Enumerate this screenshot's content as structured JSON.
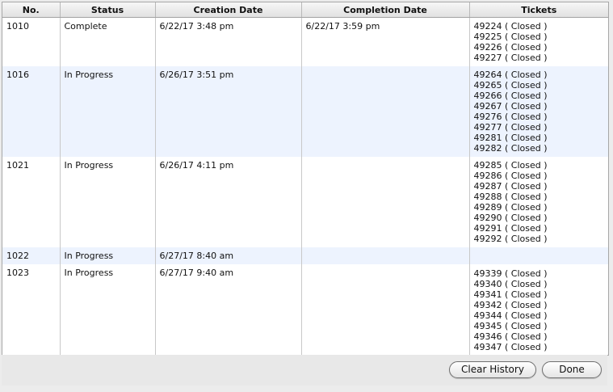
{
  "table": {
    "columns": [
      "No.",
      "Status",
      "Creation Date",
      "Completion Date",
      "Tickets"
    ],
    "rows": [
      {
        "no": "1010",
        "status": "Complete",
        "creation": "6/22/17 3:48 pm",
        "completion": "6/22/17 3:59 pm",
        "tickets": [
          "49224 ( Closed )",
          "49225 ( Closed )",
          "49226 ( Closed )",
          "49227 ( Closed )"
        ]
      },
      {
        "no": "1016",
        "status": "In Progress",
        "creation": "6/26/17 3:51 pm",
        "completion": "",
        "tickets": [
          "49264 ( Closed )",
          "49265 ( Closed )",
          "49266 ( Closed )",
          "49267 ( Closed )",
          "49276 ( Closed )",
          "49277 ( Closed )",
          "49281 ( Closed )",
          "49282 ( Closed )"
        ]
      },
      {
        "no": "1021",
        "status": "In Progress",
        "creation": "6/26/17 4:11 pm",
        "completion": "",
        "tickets": [
          "49285 ( Closed )",
          "49286 ( Closed )",
          "49287 ( Closed )",
          "49288 ( Closed )",
          "49289 ( Closed )",
          "49290 ( Closed )",
          "49291 ( Closed )",
          "49292 ( Closed )"
        ]
      },
      {
        "no": "1022",
        "status": "In Progress",
        "creation": "6/27/17 8:40 am",
        "completion": "",
        "tickets": []
      },
      {
        "no": "1023",
        "status": "In Progress",
        "creation": "6/27/17 9:40 am",
        "completion": "",
        "tickets": [
          "49339 ( Closed )",
          "49340 ( Closed )",
          "49341 ( Closed )",
          "49342 ( Closed )",
          "49344 ( Closed )",
          "49345 ( Closed )",
          "49346 ( Closed )",
          "49347 ( Closed )"
        ]
      }
    ]
  },
  "buttons": {
    "clear_history": "Clear History",
    "done": "Done"
  },
  "colors": {
    "alt_row": "#edf3fe",
    "window_bg": "#ececec"
  }
}
